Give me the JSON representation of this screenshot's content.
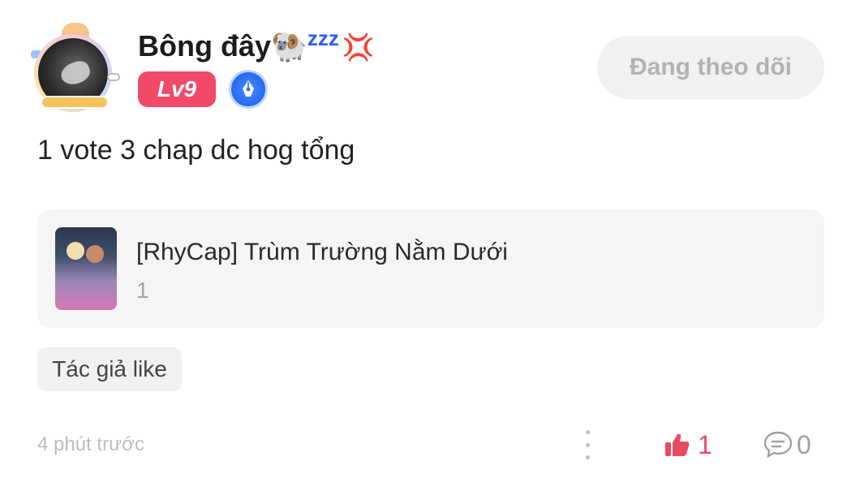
{
  "post": {
    "user": {
      "name": "Bông đây",
      "name_emoji": "🐏",
      "sleep_text": "zzz",
      "anger_emoji": "💢",
      "level": "Lv9"
    },
    "follow_label": "Đang theo dõi",
    "comment_text": "1 vote 3 chap dc hog tổng",
    "linked_item": {
      "title": "[RhyCap] Trùm Trường Nằm Dưới",
      "subtitle": "1"
    },
    "tag": "Tác giả like",
    "timestamp": "4 phút trước",
    "likes": "1",
    "comments": "0"
  },
  "colors": {
    "level_badge": "#f04a68",
    "like_accent": "#e84a64",
    "pen_badge": "#2a6ff0"
  },
  "icons": {
    "level": "level-badge",
    "creator": "pen-icon",
    "more": "more-vertical-icon",
    "like": "thumbs-up-icon",
    "comment": "comment-bubble-icon"
  }
}
